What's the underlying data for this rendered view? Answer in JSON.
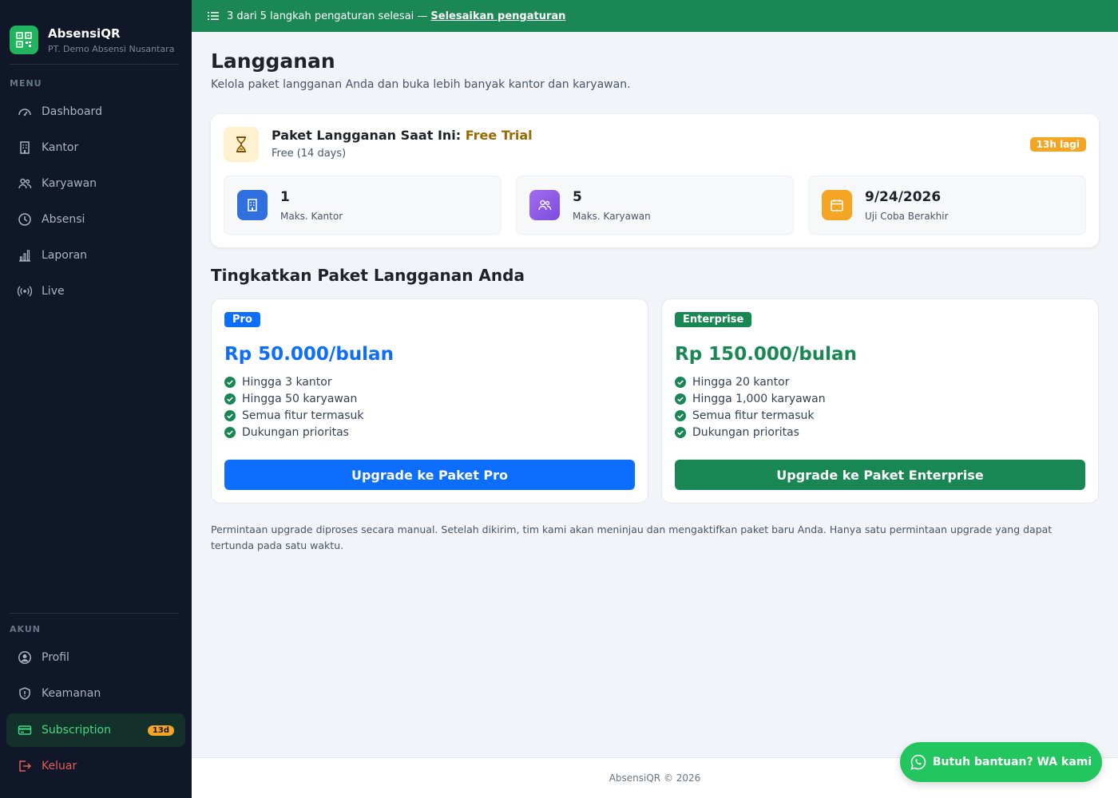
{
  "app": {
    "name": "AbsensiQR",
    "company": "PT. Demo Absensi Nusantara"
  },
  "sidebar": {
    "menu_label": "MENU",
    "menu_items": [
      {
        "label": "Dashboard",
        "icon": "gauge-icon"
      },
      {
        "label": "Kantor",
        "icon": "building-icon"
      },
      {
        "label": "Karyawan",
        "icon": "users-icon"
      },
      {
        "label": "Absensi",
        "icon": "clock-icon"
      },
      {
        "label": "Laporan",
        "icon": "bar-chart-icon"
      },
      {
        "label": "Live",
        "icon": "broadcast-icon"
      }
    ],
    "account_label": "AKUN",
    "account_items": [
      {
        "label": "Profil",
        "icon": "user-circle-icon"
      },
      {
        "label": "Keamanan",
        "icon": "shield-icon"
      },
      {
        "label": "Subscription",
        "icon": "credit-card-icon",
        "badge": "13d",
        "active": true
      },
      {
        "label": "Keluar",
        "icon": "logout-icon"
      }
    ]
  },
  "banner": {
    "text": "3 dari 5 langkah pengaturan selesai —",
    "link": "Selesaikan pengaturan"
  },
  "page": {
    "title": "Langganan",
    "subtitle": "Kelola paket langganan Anda dan buka lebih banyak kantor dan karyawan."
  },
  "current_plan": {
    "title_prefix": "Paket Langganan Saat Ini:",
    "plan_name": "Free Trial",
    "plan_detail": "Free (14 days)",
    "badge": "13h lagi",
    "stats": [
      {
        "value": "1",
        "label": "Maks. Kantor",
        "icon": "building-icon",
        "color": "#2f6fe0"
      },
      {
        "value": "5",
        "label": "Maks. Karyawan",
        "icon": "users-icon",
        "color": "#8b5cf6"
      },
      {
        "value": "9/24/2026",
        "label": "Uji Coba Berakhir",
        "icon": "calendar-icon",
        "color": "#f5a524"
      }
    ]
  },
  "upgrade": {
    "title": "Tingkatkan Paket Langganan Anda",
    "plans": [
      {
        "tag": "Pro",
        "price": "Rp 50.000/bulan",
        "color": "#0d6efd",
        "features": [
          "Hingga 3 kantor",
          "Hingga 50 karyawan",
          "Semua fitur termasuk",
          "Dukungan prioritas"
        ],
        "button": "Upgrade ke Paket Pro"
      },
      {
        "tag": "Enterprise",
        "price": "Rp 150.000/bulan",
        "color": "#198754",
        "features": [
          "Hingga 20 kantor",
          "Hingga 1,000 karyawan",
          "Semua fitur termasuk",
          "Dukungan prioritas"
        ],
        "button": "Upgrade ke Paket Enterprise"
      }
    ],
    "note": "Permintaan upgrade diproses secara manual. Setelah dikirim, tim kami akan meninjau dan mengaktifkan paket baru Anda. Hanya satu permintaan upgrade yang dapat tertunda pada satu waktu."
  },
  "footer": {
    "text": "AbsensiQR © 2026"
  },
  "help_button": {
    "label": "Butuh bantuan? WA kami",
    "icon": "whatsapp-icon"
  }
}
